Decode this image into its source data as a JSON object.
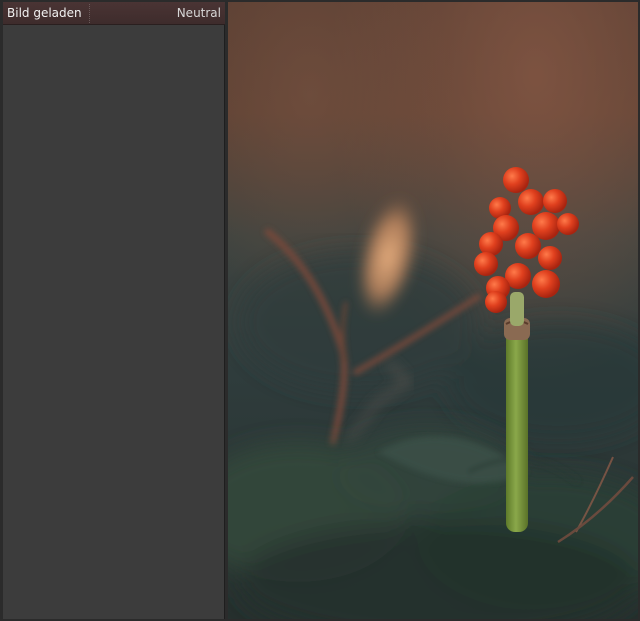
{
  "history": {
    "items": [
      {
        "label": "Bild geladen",
        "value": "Neutral"
      }
    ]
  },
  "colors": {
    "panel_background": "#3c3c3c",
    "selected_row": "#4a3434",
    "berry_red": "#e0401e",
    "stem_green": "#7a9a3a"
  },
  "preview": {
    "subject": "photo-preview"
  }
}
